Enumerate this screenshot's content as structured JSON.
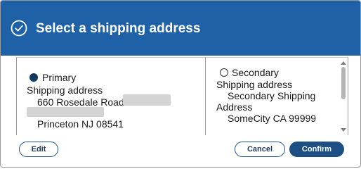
{
  "dialog": {
    "title": "Select a shipping address",
    "header_icon": "check-circle-icon",
    "header_color": "#1e61a6"
  },
  "addresses": {
    "primary": {
      "label": "Primary",
      "selected": true,
      "type_label": "Shipping address",
      "street": "660 Rosedale Road",
      "city_line": "Princeton NJ 08541"
    },
    "secondary": {
      "label": "Secondary",
      "selected": false,
      "type_label": "Shipping address",
      "line1": "Secondary Shipping",
      "line2": "Address",
      "city_line": "SomeCity CA 99999"
    }
  },
  "buttons": {
    "edit": "Edit",
    "cancel": "Cancel",
    "confirm": "Confirm"
  },
  "colors": {
    "accent": "#1e4f84",
    "radio_selected": "#0f3a5e"
  }
}
